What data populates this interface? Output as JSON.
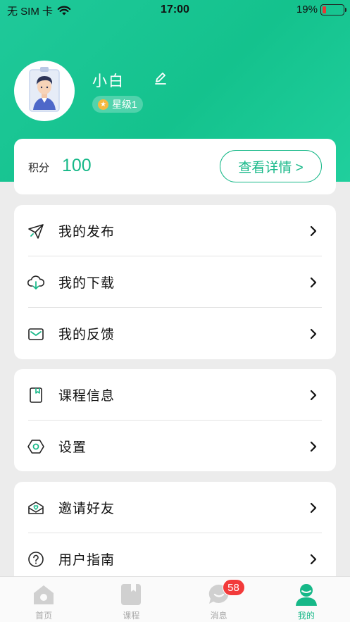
{
  "status_bar": {
    "carrier": "无 SIM 卡",
    "time": "17:00",
    "battery": "19%",
    "battery_level": 0.19,
    "battery_color": "#e53935"
  },
  "profile": {
    "name": "小白",
    "level": "星级1"
  },
  "points": {
    "label": "积分",
    "value": "100",
    "detail_button": "查看详情 >"
  },
  "menu_groups": [
    [
      {
        "label": "我的发布",
        "icon": "paper-plane-icon"
      },
      {
        "label": "我的下载",
        "icon": "cloud-download-icon"
      },
      {
        "label": "我的反馈",
        "icon": "mail-icon"
      }
    ],
    [
      {
        "label": "课程信息",
        "icon": "book-icon"
      },
      {
        "label": "设置",
        "icon": "hexagon-settings-icon"
      }
    ],
    [
      {
        "label": "邀请好友",
        "icon": "invite-envelope-icon"
      },
      {
        "label": "用户指南",
        "icon": "question-circle-icon"
      }
    ]
  ],
  "tabs": [
    {
      "label": "首页",
      "icon": "home-icon"
    },
    {
      "label": "课程",
      "icon": "book-icon"
    },
    {
      "label": "消息",
      "icon": "message-icon",
      "badge": "58"
    },
    {
      "label": "我的",
      "icon": "user-icon",
      "active": true
    }
  ],
  "colors": {
    "accent": "#16b888",
    "header": "#1fc99a",
    "badge": "#f23a3a"
  }
}
